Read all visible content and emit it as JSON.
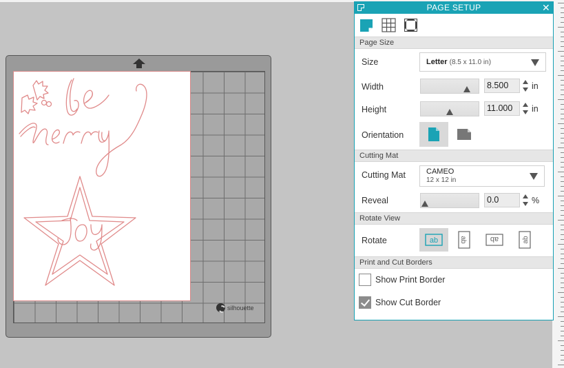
{
  "panel": {
    "title": "PAGE SETUP",
    "close_label": "✕"
  },
  "mode_icons": [
    "media-icon",
    "registration-marks-icon",
    "page-view-icon"
  ],
  "sections": {
    "page_size": "Page Size",
    "cutting_mat": "Cutting Mat",
    "rotate_view": "Rotate View",
    "borders": "Print and Cut Borders"
  },
  "size": {
    "label": "Size",
    "value": "Letter",
    "detail": "(8.5 x 11.0 in)"
  },
  "width": {
    "label": "Width",
    "value": "8.500",
    "unit": "in",
    "slider_fraction": 0.85
  },
  "height": {
    "label": "Height",
    "value": "11.000",
    "unit": "in",
    "slider_fraction": 0.5
  },
  "orientation": {
    "label": "Orientation",
    "options": [
      "portrait-icon",
      "landscape-icon"
    ],
    "selected": "portrait"
  },
  "cutting_mat": {
    "label": "Cutting Mat",
    "value": "CAMEO",
    "detail": "12 x 12 in"
  },
  "reveal": {
    "label": "Reveal",
    "value": "0.0",
    "unit": "%",
    "slider_fraction": 0.0
  },
  "rotate": {
    "label": "Rotate",
    "selected_index": 0,
    "glyph": "ab"
  },
  "borders": {
    "print": {
      "label": "Show Print Border",
      "checked": false
    },
    "cut": {
      "label": "Show Cut Border",
      "checked": true
    }
  },
  "brand": {
    "name": "silhouette"
  },
  "colors": {
    "accent": "#1aa3b5",
    "design_outline": "#e08a8a",
    "mat": "#a9a9a9"
  }
}
